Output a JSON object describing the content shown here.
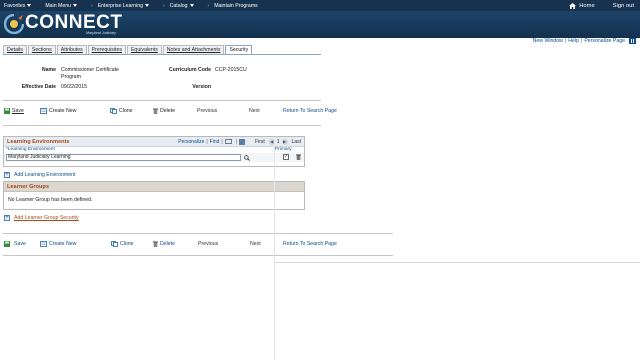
{
  "topnav": {
    "menus": [
      {
        "label": "Favorites",
        "caret": true
      },
      {
        "label": "Main Menu",
        "caret": true
      },
      {
        "label": "Enterprise Learning",
        "caret": true
      },
      {
        "label": "Catalog",
        "caret": true
      },
      {
        "label": "Maintain Programs",
        "caret": false
      }
    ],
    "home_label": "Home",
    "signout_label": "Sign out"
  },
  "banner": {
    "brand": "CONNECT",
    "subtitle": "Maryland Judiciary"
  },
  "toolbar": {
    "new_window": "New Window",
    "help": "Help",
    "personalize_page": "Personalize Page"
  },
  "tabs": [
    {
      "label": "Details",
      "active": false
    },
    {
      "label": "Sections",
      "active": false
    },
    {
      "label": "Attributes",
      "active": false
    },
    {
      "label": "Prerequisites",
      "active": false
    },
    {
      "label": "Equivalents",
      "active": false
    },
    {
      "label": "Notes and Attachments",
      "active": false
    },
    {
      "label": "Security",
      "active": true
    }
  ],
  "form": {
    "name_label": "Name",
    "name_value_line1": "Commissioner Certificate",
    "name_value_line2": "Program",
    "curriculum_code_label": "Curriculum Code",
    "curriculum_code_value": "CCP-2015CU",
    "effective_date_label": "Effective Date",
    "effective_date_value": "09/22/2015",
    "version_label": "Version"
  },
  "actions": {
    "save": "Save",
    "create_new": "Create New",
    "clone": "Clone",
    "delete": "Delete",
    "previous": "Previous",
    "next": "Next",
    "return": "Return To Search Page"
  },
  "learning_env": {
    "title": "Learning Environments",
    "personalize": "Personalize",
    "find": "Find",
    "first": "First",
    "last": "Last",
    "col_env": "*Learning Environment",
    "col_primary": "Primary",
    "rows": [
      {
        "env": "Maryland Judiciary Learning",
        "primary": true
      }
    ],
    "add_label": "Add Learning Environment"
  },
  "learner_groups": {
    "title": "Learner Groups",
    "empty_msg": "No Learner Group has been defined.",
    "add_label": "Add Learner Group Security"
  },
  "colors": {
    "nav_bg": "#16324f",
    "link": "#0a4c8f",
    "section_title": "#a44a1c"
  }
}
